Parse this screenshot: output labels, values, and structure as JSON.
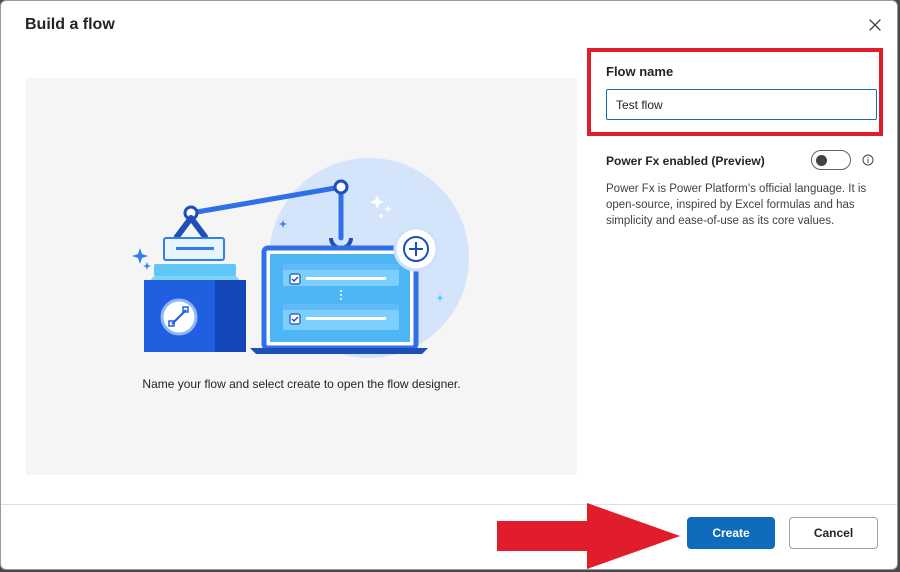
{
  "dialog": {
    "title": "Build a flow",
    "close_icon": "close-icon"
  },
  "illustration": {
    "caption": "Name your flow and select create to open the flow designer."
  },
  "form": {
    "flow_name_label": "Flow name",
    "flow_name_value": "Test flow",
    "power_fx_label": "Power Fx enabled (Preview)",
    "power_fx_enabled": false,
    "power_fx_description": "Power Fx is Power Platform's official language. It is open-source, inspired by Excel formulas and has simplicity and ease-of-use as its core values.",
    "info_icon": "info-icon"
  },
  "footer": {
    "create_label": "Create",
    "cancel_label": "Cancel"
  },
  "colors": {
    "primary": "#0f6cbd",
    "annotation_red": "#e11c2b"
  }
}
